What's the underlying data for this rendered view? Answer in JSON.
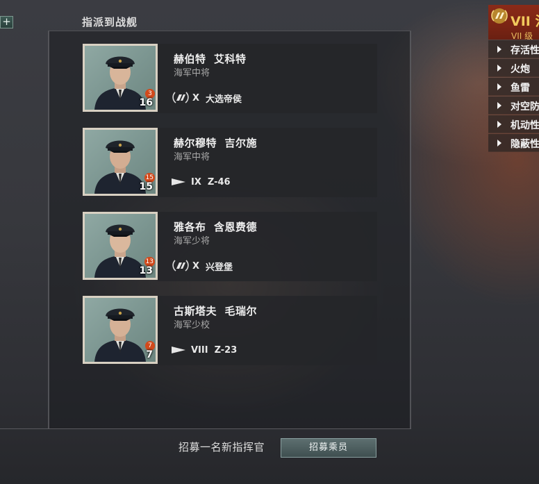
{
  "panel": {
    "title": "指派到战舰"
  },
  "commanders": [
    {
      "name": "赫伯特  艾科特",
      "rank": "海军中将",
      "level": "16",
      "skill_points": "3",
      "ship_tier": "X",
      "ship_name": "大选帝侯",
      "ship_icon": "premium-laurel-icon"
    },
    {
      "name": "赫尔穆特  吉尔施",
      "rank": "海军中将",
      "level": "15",
      "skill_points": "15",
      "ship_tier": "IX",
      "ship_name": "Z-46",
      "ship_icon": "destroyer-flag-icon"
    },
    {
      "name": "雅各布  含恩费德",
      "rank": "海军少将",
      "level": "13",
      "skill_points": "13",
      "ship_tier": "X",
      "ship_name": "兴登堡",
      "ship_icon": "premium-laurel-icon"
    },
    {
      "name": "古斯塔夫  毛瑞尔",
      "rank": "海军少校",
      "level": "7",
      "skill_points": "7",
      "ship_tier": "VIII",
      "ship_name": "Z-23",
      "ship_icon": "destroyer-flag-icon"
    }
  ],
  "recruit": {
    "text": "招募一名新指挥官",
    "button_label": "招募乘员"
  },
  "ship_panel": {
    "tier_roman": "VII 泫",
    "tier_sub": "VII 级",
    "stats": [
      "存活性",
      "火炮",
      "鱼雷",
      "对空防",
      "机动性",
      "隐蔽性"
    ]
  },
  "colors": {
    "skill_badge": "#d24a1c",
    "tier_gold": "#f1c95c",
    "header_red": "#7a2414"
  }
}
